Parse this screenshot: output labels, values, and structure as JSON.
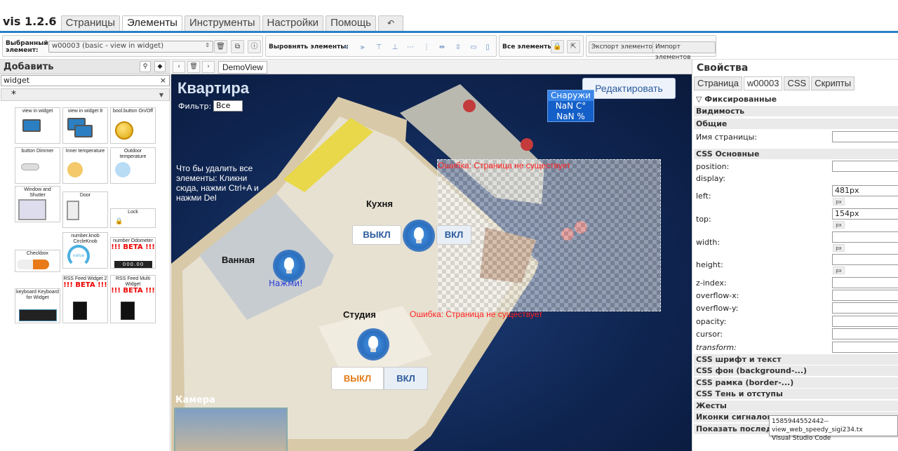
{
  "app": {
    "brand": "vis 1.2.6"
  },
  "tabs": [
    {
      "label": "Страницы"
    },
    {
      "label": "Элементы"
    },
    {
      "label": "Инструменты"
    },
    {
      "label": "Настройки"
    },
    {
      "label": "Помощь"
    },
    {
      "label": "↶"
    }
  ],
  "toolbar": {
    "selected_label": "Выбранный элемент:",
    "selected_value": "w00003 (basic - view in widget)",
    "align_label": "Выровнять элементы:",
    "all_label": "Все элементы:",
    "export_label": "Экспорт элементов",
    "import_label": "Импорт элементов"
  },
  "left": {
    "title": "Добавить",
    "filter_value": "widget",
    "category": "*",
    "widgets": [
      {
        "label": "view in widget"
      },
      {
        "label": "view in widget 8"
      },
      {
        "label": "bool.button On/Off"
      },
      {
        "label": "button Dimmer"
      },
      {
        "label": "Inner temperature"
      },
      {
        "label": "Outdoor temperature"
      },
      {
        "label": "Window and Shutter"
      },
      {
        "label": "Door"
      },
      {
        "label": "Lock"
      },
      {
        "label": "Checkbox"
      },
      {
        "label": "number.knob CircleKnob"
      },
      {
        "label": "number Odometer",
        "beta": "!!! BETA !!!"
      },
      {
        "label": "keyboard Keyboard for Widget"
      },
      {
        "label": "RSS Feed Widget 2",
        "beta": "!!! BETA !!!"
      },
      {
        "label": "RSS Feed Multi Widget",
        "beta": "!!! BETA !!!"
      }
    ],
    "knob_value": "value",
    "odometer_value": "000.00"
  },
  "editor": {
    "view_tab": "DemoView"
  },
  "canvas": {
    "title": "Квартира",
    "filter_label": "Фильтр:",
    "filter_value": "Все",
    "edit_button": "Редактировать",
    "weather_out": "Снаружи",
    "weather_temp": "NaN C°",
    "weather_hum": "NaN %",
    "delete_info": "Что бы удалить все элементы: Кликни сюда, нажми Ctrl+A и нажми Del",
    "error1": "Ошибка: Страница не существует",
    "error2": "Ошибка: Страница не существует",
    "room_kitchen": "Кухня",
    "room_bath": "Ванная",
    "room_studio": "Студия",
    "press": "Нажми!",
    "off1": "ВЫКЛ",
    "on1": "ВКЛ",
    "off2": "ВЫКЛ",
    "on2": "ВКЛ",
    "camera": "Камера"
  },
  "right": {
    "title": "Свойства",
    "tabs": [
      "Страница",
      "w00003",
      "CSS",
      "Скрипты"
    ],
    "sections": {
      "fixed": "Фиксированные",
      "visibility": "Видимость",
      "common": "Общие",
      "css_basic": "CSS Основные",
      "css_font": "CSS шрифт и текст",
      "css_bg": "CSS фон (background-...)",
      "css_border": "CSS рамка (border-...)",
      "css_shadow": "CSS Тень и отступы",
      "gestures": "Жесты",
      "signal_icons": "Иконки сигналов",
      "show_last": "Показать последн"
    },
    "props": {
      "page_name": "Имя страницы:",
      "position": "position:",
      "display": "display:",
      "left": "left:",
      "left_value": "481px",
      "top": "top:",
      "top_value": "154px",
      "width": "width:",
      "height": "height:",
      "zindex": "z-index:",
      "overflow_x": "overflow-x:",
      "overflow_y": "overflow-y:",
      "opacity": "opacity:",
      "cursor": "cursor:",
      "transform": "transform:",
      "unit": "px"
    }
  },
  "tooltip": {
    "line1": "1585944552442--view_web_speedy_sigi234.tx",
    "line2": "Visual Studio Code"
  }
}
